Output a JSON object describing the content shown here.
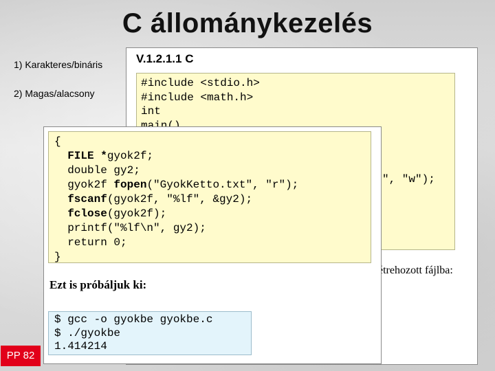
{
  "slide": {
    "title": "C állománykezelés",
    "bullet1": "1)  Karakteres/bináris",
    "bullet2": "2)  Magas/alacsony",
    "page_badge": "PP 82"
  },
  "window_back": {
    "heading": "V.1.2.1.1 C",
    "code_lines": "#include <stdio.h>\n#include <math.h>\nint\nmain()",
    "code_tail": "\", \"w\");",
    "text_tail": "étrehozott fájlba:"
  },
  "window_front": {
    "code": {
      "l1": "{",
      "l2_kw": "FILE *",
      "l2_rest": "gyok2f;",
      "l3": "double gy2;",
      "l4_a": "gyok2f ",
      "l4_kw": "fopen",
      "l4_b": "(\"GyokKetto.txt\", \"r\");",
      "l5_kw": "fscanf",
      "l5_rest": "(gyok2f, \"%lf\", &gy2);",
      "l6_kw": "fclose",
      "l6_rest": "(gyok2f);",
      "l7": "printf(\"%lf\\n\", gy2);",
      "l8": "return 0;",
      "l9": "}"
    },
    "prompt_text": "Ezt is próbáljuk ki:",
    "terminal": "$ gcc -o gyokbe gyokbe.c\n$ ./gyokbe\n1.414214"
  }
}
